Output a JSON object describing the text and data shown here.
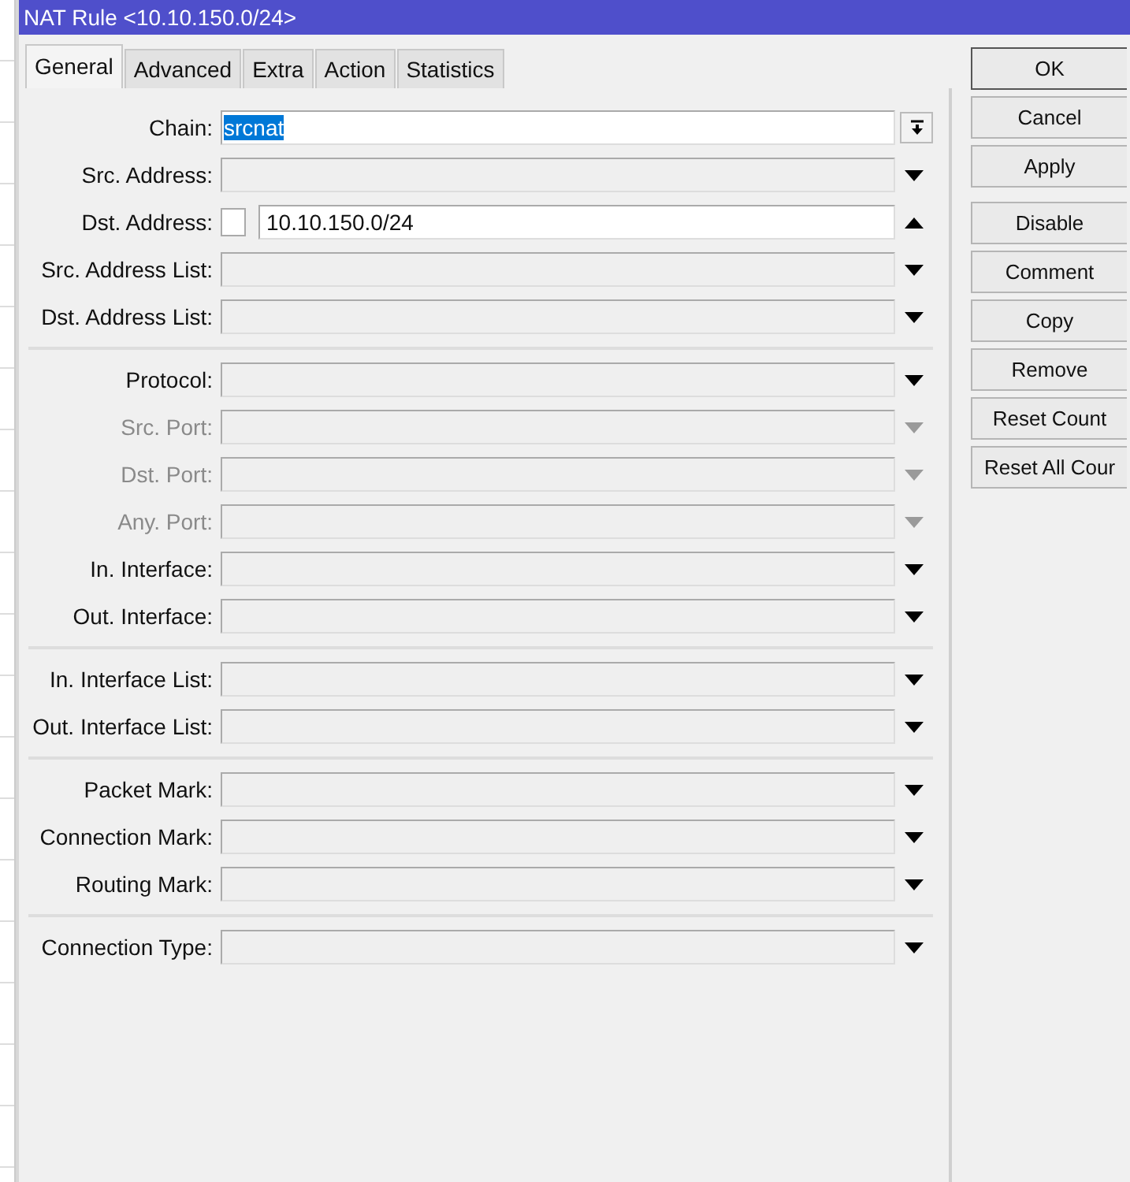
{
  "window": {
    "title": "NAT Rule <10.10.150.0/24>"
  },
  "tabs": [
    {
      "label": "General",
      "selected": true
    },
    {
      "label": "Advanced",
      "selected": false
    },
    {
      "label": "Extra",
      "selected": false
    },
    {
      "label": "Action",
      "selected": false
    },
    {
      "label": "Statistics",
      "selected": false
    }
  ],
  "field_groups": [
    [
      {
        "kind": "combo",
        "label": "Chain:",
        "value": "srcnat",
        "value_selected": true,
        "disabled": false
      },
      {
        "kind": "dropdown",
        "label": "Src. Address:",
        "disabled": false
      },
      {
        "kind": "negatable",
        "label": "Dst. Address:",
        "value": "10.10.150.0/24",
        "negated": false,
        "expanded": true,
        "disabled": false
      },
      {
        "kind": "dropdown",
        "label": "Src. Address List:",
        "disabled": false
      },
      {
        "kind": "dropdown",
        "label": "Dst. Address List:",
        "disabled": false
      }
    ],
    [
      {
        "kind": "dropdown",
        "label": "Protocol:",
        "disabled": false
      },
      {
        "kind": "dropdown",
        "label": "Src. Port:",
        "disabled": true
      },
      {
        "kind": "dropdown",
        "label": "Dst. Port:",
        "disabled": true
      },
      {
        "kind": "dropdown",
        "label": "Any. Port:",
        "disabled": true
      },
      {
        "kind": "dropdown",
        "label": "In. Interface:",
        "disabled": false
      },
      {
        "kind": "dropdown",
        "label": "Out. Interface:",
        "disabled": false
      }
    ],
    [
      {
        "kind": "dropdown",
        "label": "In. Interface List:",
        "disabled": false
      },
      {
        "kind": "dropdown",
        "label": "Out. Interface List:",
        "disabled": false
      }
    ],
    [
      {
        "kind": "dropdown",
        "label": "Packet Mark:",
        "disabled": false
      },
      {
        "kind": "dropdown",
        "label": "Connection Mark:",
        "disabled": false
      },
      {
        "kind": "dropdown",
        "label": "Routing Mark:",
        "disabled": false
      }
    ],
    [
      {
        "kind": "dropdown",
        "label": "Connection Type:",
        "disabled": false
      }
    ]
  ],
  "button_groups": [
    [
      {
        "label": "OK",
        "default": true
      },
      {
        "label": "Cancel",
        "default": false
      },
      {
        "label": "Apply",
        "default": false
      }
    ],
    [
      {
        "label": "Disable",
        "default": false
      },
      {
        "label": "Comment",
        "default": false
      },
      {
        "label": "Copy",
        "default": false
      },
      {
        "label": "Remove",
        "default": false
      },
      {
        "label": "Reset Count",
        "default": false
      },
      {
        "label": "Reset All Cour",
        "default": false
      }
    ]
  ]
}
